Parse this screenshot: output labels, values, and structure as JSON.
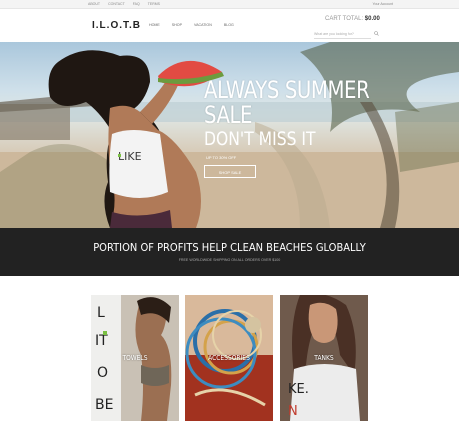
{
  "topbar": {
    "links": [
      "ABOUT",
      "CONTACT",
      "FAQ",
      "TERMS"
    ],
    "account": "Your Account"
  },
  "header": {
    "logo": "I.L.O.T.B",
    "nav": [
      "HOME",
      "SHOP",
      "VACATION",
      "BLOG"
    ],
    "cart_label": "CART TOTAL:",
    "cart_total": "$0.00",
    "search_placeholder": "What are you looking for?"
  },
  "hero": {
    "title_line1": "ALWAYS SUMMER",
    "title_line2": "SALE",
    "subtitle": "DON'T MISS IT",
    "promo": "UP TO 30% OFF",
    "cta": "SHOP SALE"
  },
  "band": {
    "headline": "PORTION OF PROFITS HELP CLEAN BEACHES GLOBALLY",
    "sub": "FREE WORLDWIDE SHIPPING ON ALL ORDERS OVER $100"
  },
  "categories": [
    {
      "label": "TOWELS"
    },
    {
      "label": "ACCESSORIES"
    },
    {
      "label": "TANKS"
    }
  ],
  "colors": {
    "band_bg": "#222222",
    "accent_green": "#7ac142"
  }
}
